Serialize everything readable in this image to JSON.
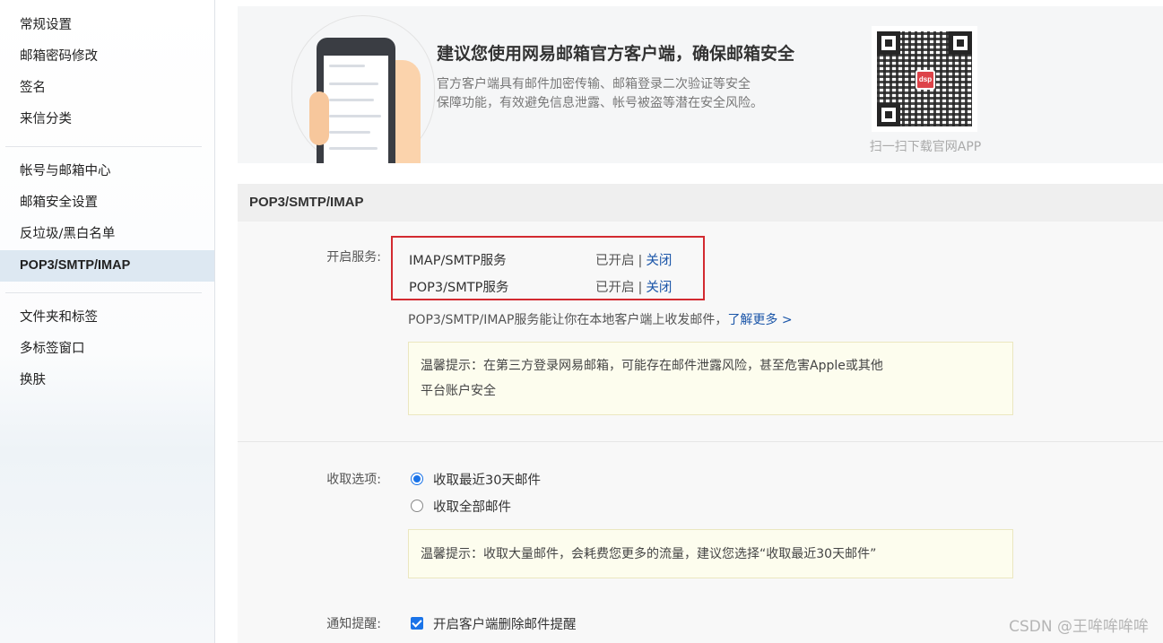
{
  "sidebar": {
    "group1": [
      {
        "label": "常规设置"
      },
      {
        "label": "邮箱密码修改"
      },
      {
        "label": "签名"
      },
      {
        "label": "来信分类"
      }
    ],
    "group2": [
      {
        "label": "帐号与邮箱中心"
      },
      {
        "label": "邮箱安全设置"
      },
      {
        "label": "反垃圾/黑白名单"
      },
      {
        "label": "POP3/SMTP/IMAP",
        "active": true
      }
    ],
    "group3": [
      {
        "label": "文件夹和标签"
      },
      {
        "label": "多标签窗口"
      },
      {
        "label": "换肤"
      }
    ]
  },
  "banner": {
    "title": "建议您使用网易邮箱官方客户端，确保邮箱安全",
    "desc_line1": "官方客户端具有邮件加密传输、邮箱登录二次验证等安全",
    "desc_line2": "保障功能，有效避免信息泄露、帐号被盗等潜在安全风险。",
    "qr_caption": "扫一扫下载官网APP",
    "qr_logo": "dsp"
  },
  "section": {
    "title": "POP3/SMTP/IMAP",
    "services_label": "开启服务:",
    "services": [
      {
        "name": "IMAP/SMTP服务",
        "status": "已开启",
        "sep": "|",
        "action": "关闭"
      },
      {
        "name": "POP3/SMTP服务",
        "status": "已开启",
        "sep": "|",
        "action": "关闭"
      }
    ],
    "desc": "POP3/SMTP/IMAP服务能让你在本地客户端上收发邮件，",
    "learn_more": "了解更多 >",
    "tip1_line1": "温馨提示：在第三方登录网易邮箱，可能存在邮件泄露风险，甚至危害Apple或其他",
    "tip1_line2": "平台账户安全",
    "receive_label": "收取选项:",
    "receive_options": [
      {
        "label": "收取最近30天邮件",
        "checked": true
      },
      {
        "label": "收取全部邮件",
        "checked": false
      }
    ],
    "tip2": "温馨提示：收取大量邮件，会耗费您更多的流量，建议您选择“收取最近30天邮件”",
    "notify_label": "通知提醒:",
    "notify_option": "开启客户端删除邮件提醒",
    "notify_checked": true
  },
  "watermark": "CSDN @王哞哞哞哞",
  "colors": {
    "link": "#1a55a8",
    "highlight_border": "#d32a30",
    "control_blue": "#1a73e8",
    "sidebar_active": "#dde8f2"
  }
}
